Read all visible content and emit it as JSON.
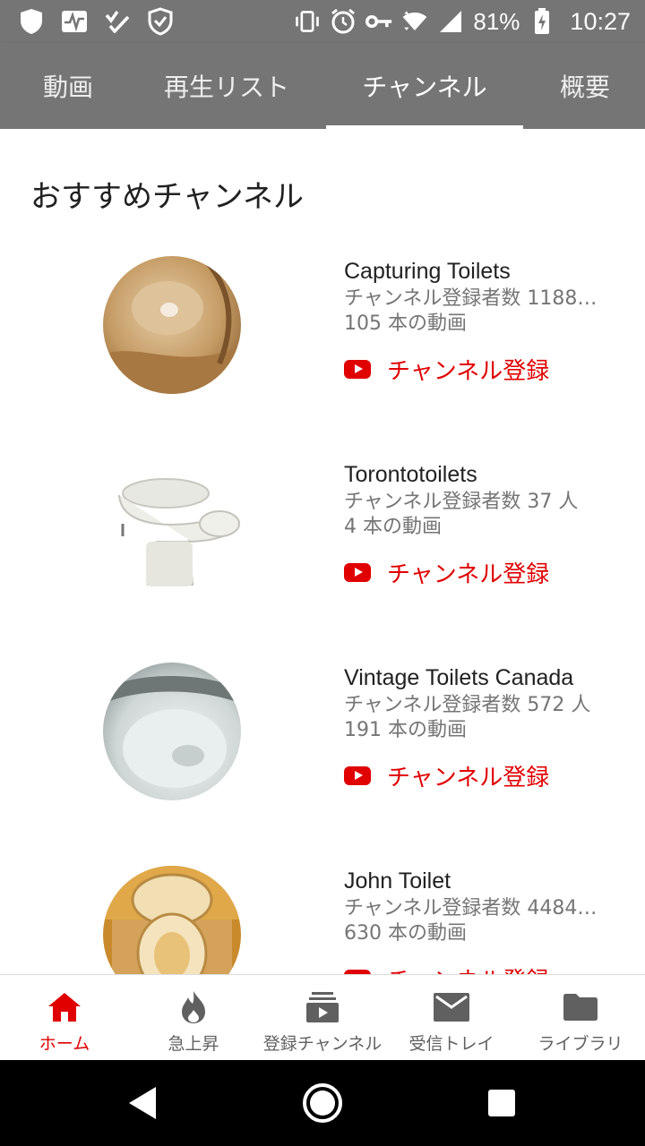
{
  "status_bar": {
    "battery": "81%",
    "time": "10:27"
  },
  "tabs": [
    {
      "label": "動画"
    },
    {
      "label": "再生リスト"
    },
    {
      "label": "チャンネル"
    },
    {
      "label": "概要"
    }
  ],
  "section_title": "おすすめチャンネル",
  "channels": [
    {
      "name": "Capturing Toilets",
      "subscribers": "チャンネル登録者数 1188…",
      "videos": "105 本の動画",
      "subscribe_label": "チャンネル登録"
    },
    {
      "name": "Torontotoilets",
      "subscribers": "チャンネル登録者数 37 人",
      "videos": "4 本の動画",
      "subscribe_label": "チャンネル登録"
    },
    {
      "name": "Vintage Toilets Canada",
      "subscribers": "チャンネル登録者数 572 人",
      "videos": "191 本の動画",
      "subscribe_label": "チャンネル登録"
    },
    {
      "name": "John Toilet",
      "subscribers": "チャンネル登録者数 4484…",
      "videos": "630 本の動画",
      "subscribe_label": "チャンネル登録"
    }
  ],
  "bottom_nav": [
    {
      "label": "ホーム",
      "icon": "home-icon"
    },
    {
      "label": "急上昇",
      "icon": "flame-icon"
    },
    {
      "label": "登録チャンネル",
      "icon": "subscriptions-icon"
    },
    {
      "label": "受信トレイ",
      "icon": "mail-icon"
    },
    {
      "label": "ライブラリ",
      "icon": "folder-icon"
    }
  ],
  "colors": {
    "header_bg": "#757575",
    "accent_red": "#e00000"
  }
}
